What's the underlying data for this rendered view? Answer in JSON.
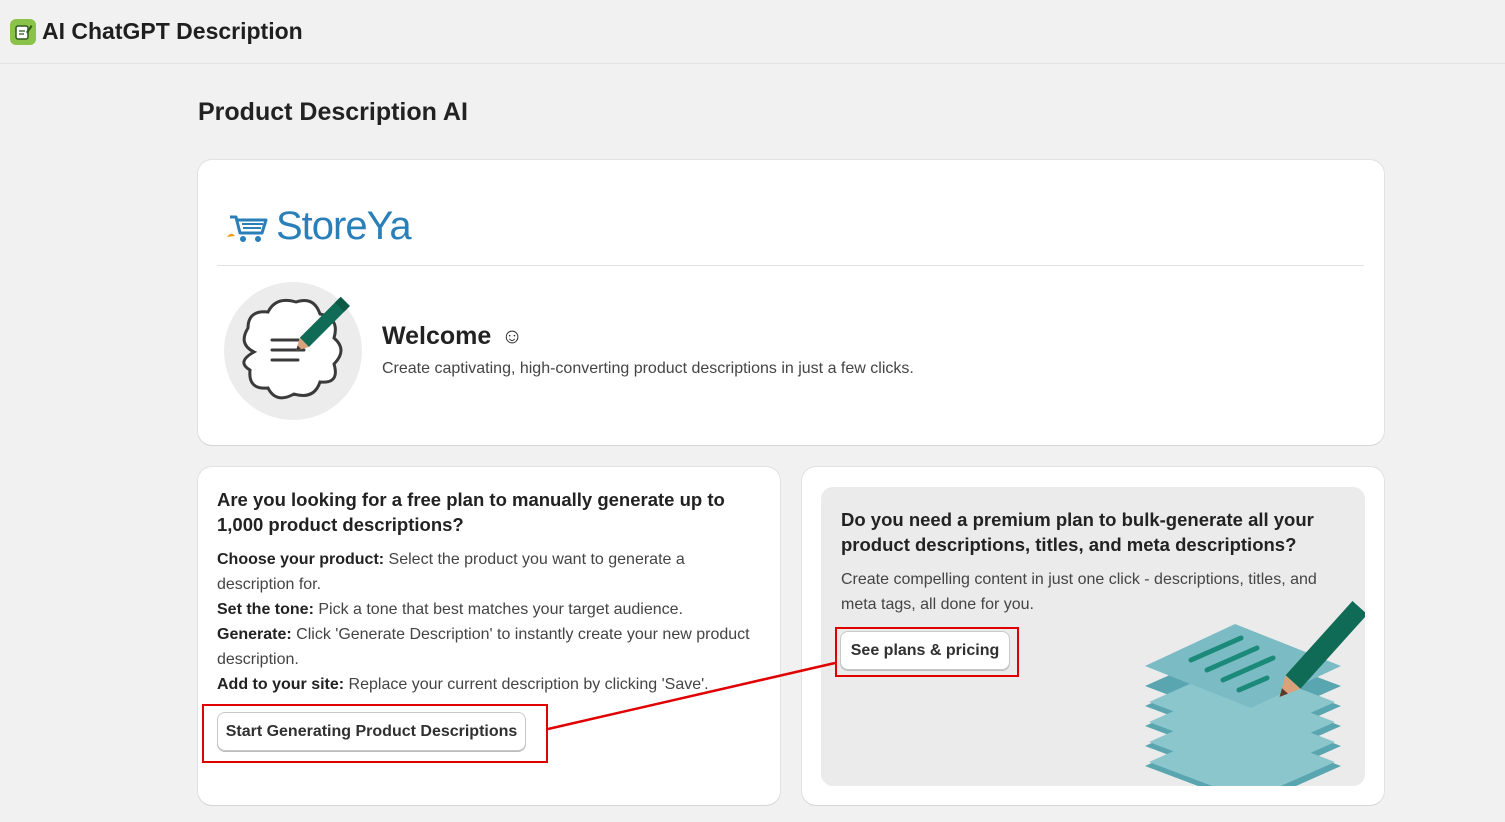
{
  "app": {
    "title": "AI ChatGPT Description",
    "icon": "notepad-pencil-icon",
    "icon_color": "#8bc34a"
  },
  "page": {
    "title": "Product Description AI"
  },
  "welcome": {
    "logo_text": "StoreYa",
    "logo_icon": "shopping-cart-icon",
    "title": "Welcome",
    "emoji": "☺",
    "subtitle": "Create captivating, high-converting product descriptions in just a few clicks."
  },
  "free_plan": {
    "title": "Are you looking for a free plan to manually generate up to 1,000 product descriptions?",
    "steps": [
      {
        "label": "Choose your product:",
        "text": " Select the product you want to generate a description for."
      },
      {
        "label": "Set the tone:",
        "text": " Pick a tone that best matches your target audience."
      },
      {
        "label": "Generate:",
        "text": " Click 'Generate Description' to instantly create your new product description."
      },
      {
        "label": "Add to your site:",
        "text": " Replace your current description by clicking 'Save'."
      }
    ],
    "button_label": "Start Generating Product Descriptions"
  },
  "premium_plan": {
    "title": "Do you need a premium plan to bulk-generate all your product descriptions, titles, and meta descriptions?",
    "subtitle": "Create compelling content in just one click - descriptions, titles, and meta tags, all done for you.",
    "button_label": "See plans & pricing"
  },
  "colors": {
    "highlight": "#e00000",
    "brand_blue": "#2a7fb8",
    "pencil_green": "#0f6b55",
    "paper_teal": "#7bbcc4"
  }
}
